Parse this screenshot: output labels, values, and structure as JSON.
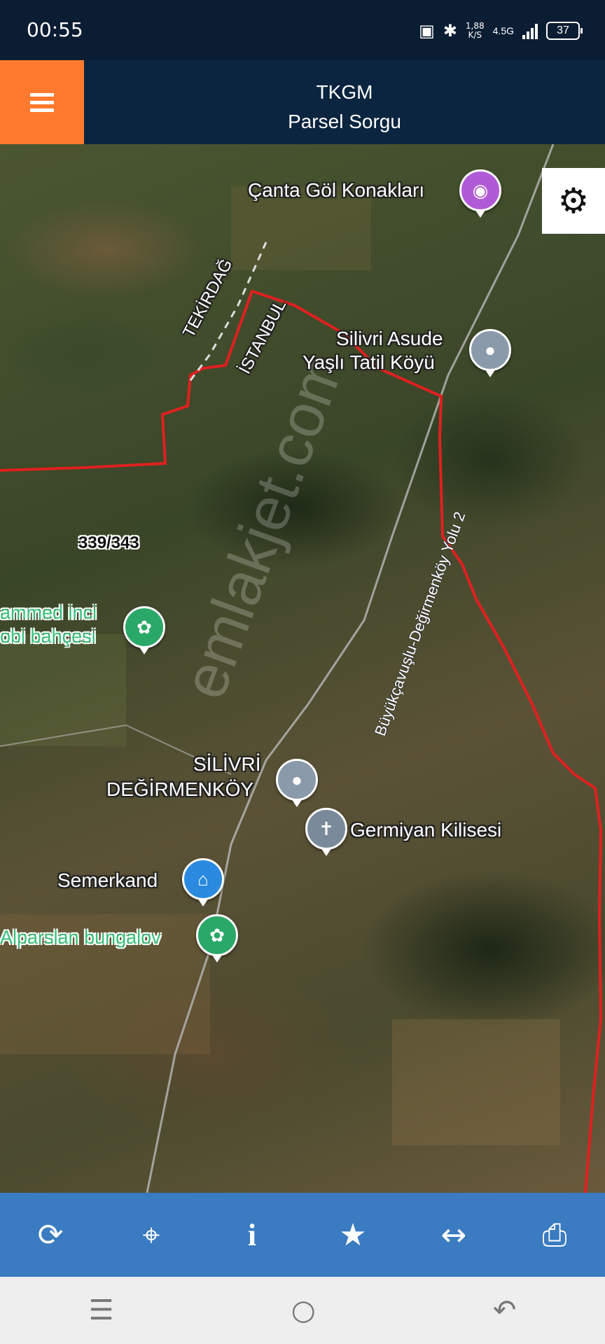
{
  "status": {
    "time": "00:55",
    "net_speed_value": "1,88",
    "net_speed_unit": "K/S",
    "network": "4.5G",
    "battery": "37"
  },
  "appbar": {
    "title": "TKGM",
    "subtitle": "Parsel Sorgu"
  },
  "map": {
    "parcel_label": "339/343",
    "places": {
      "canta": "Çanta Göl Konakları",
      "asude_line1": "Silivri Asude",
      "asude_line2": "Yaşlı Tatil Köyü",
      "tekirdag": "TEKİRDAĞ",
      "istanbul": "İSTANBUL",
      "muhammed_line1": "ammed inci",
      "muhammed_line2": "obi bahçesi",
      "silivri_line1": "SİLİVRİ",
      "silivri_line2": "DEĞİRMENKÖY",
      "germiyan": "Germiyan Kilisesi",
      "semerkand": "Semerkand",
      "alparslan": "Alparslan bungalov",
      "road": "Büyükçavuşlu-Değirmenköy Yolu 2"
    },
    "watermark": "emlakjet.com"
  },
  "toolbar": {
    "icons": [
      "refresh-icon",
      "locate-icon",
      "info-icon",
      "star-icon",
      "measure-icon",
      "print-icon"
    ]
  },
  "colors": {
    "menu_button": "#ff7a2f",
    "appbar": "#0b2540",
    "toolbar": "#3a7bc1",
    "boundary": "#e02020"
  }
}
